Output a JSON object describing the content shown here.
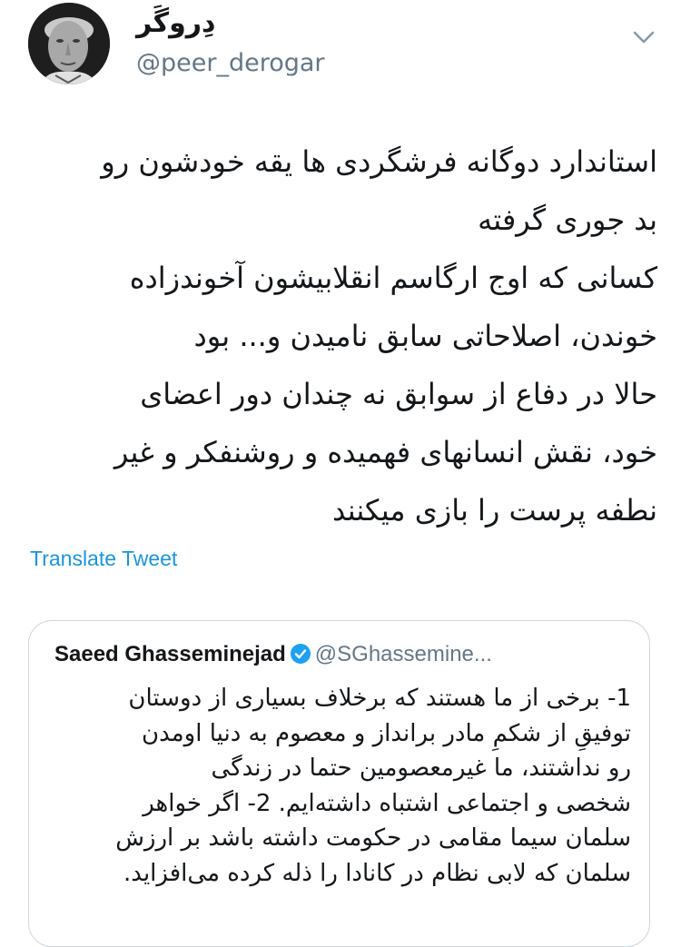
{
  "author": {
    "display_name": "دِروگَر",
    "handle": "@peer_derogar",
    "avatar_icon": "person-portrait-avatar"
  },
  "menu": {
    "icon": "chevron-down-icon"
  },
  "tweet": {
    "lines": [
      "استاندارد دوگانه فرشگردی ها یقه خودشون رو",
      "بد جوری گرفته",
      "کسانی که اوج ارگاسم انقلابیشون آخوندزاده",
      "خوندن، اصلاحاتی سابق نامیدن و... بود",
      "حالا در دفاع از سوابق نه چندان دور اعضای",
      "خود، نقش انسانهای فهمیده و روشنفکر و غیر",
      "نطفه پرست را بازی میکنند"
    ]
  },
  "translate_label": "Translate Tweet",
  "quoted_tweet": {
    "author_name": "Saeed Ghasseminejad",
    "handle": "@SGhassemine...",
    "verified_color": "#1da1f2",
    "lines": [
      "1- برخی از ما هستند که برخلاف بسیاری از دوستان",
      "توفیقِ از شکمِ مادر برانداز و معصوم به دنیا اومدن",
      "رو نداشتند، ما غیرمعصومین حتما در زندگی",
      "شخصی و اجتماعی اشتباه داشته‌ایم. 2- اگر خواهر",
      "سلمان سیما مقامی در حکومت داشته باشد بر ارزش",
      "سلمان که لابی نظام در کانادا را ذله کرده می‌افزاید."
    ]
  }
}
